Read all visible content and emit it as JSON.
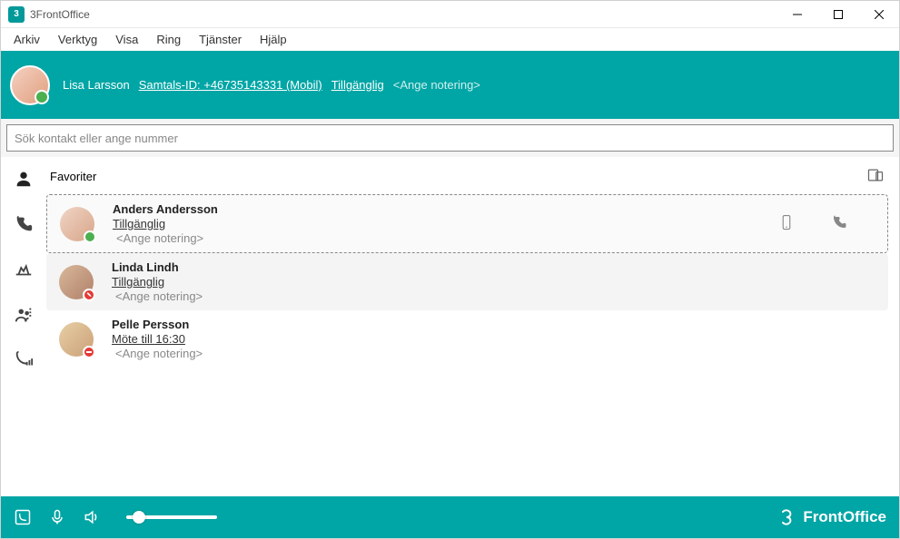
{
  "window": {
    "title": "3FrontOffice"
  },
  "menu": [
    "Arkiv",
    "Verktyg",
    "Visa",
    "Ring",
    "Tjänster",
    "Hjälp"
  ],
  "header": {
    "user_name": "Lisa Larsson",
    "caller_id": "Samtals-ID: +46735143331 (Mobil)",
    "presence": "Tillgänglig",
    "note_placeholder": "<Ange notering>"
  },
  "search": {
    "placeholder": "Sök kontakt eller ange nummer"
  },
  "section_title": "Favoriter",
  "contacts": [
    {
      "name": "Anders Andersson",
      "status": "Tillgänglig",
      "note": "<Ange notering>",
      "badge": "green",
      "selected": true,
      "show_actions": true
    },
    {
      "name": "Linda Lindh",
      "status": "Tillgänglig",
      "note": "<Ange notering>",
      "badge": "redcall",
      "hover": true
    },
    {
      "name": "Pelle Persson",
      "status": "Möte till 16:30",
      "note": "<Ange notering>",
      "badge": "dnd"
    }
  ],
  "brand": "FrontOffice"
}
